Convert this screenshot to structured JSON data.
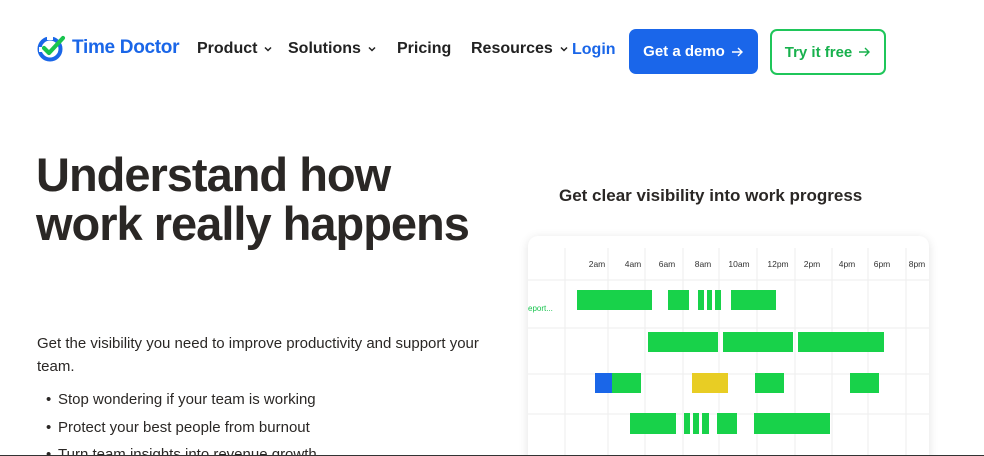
{
  "brand": {
    "name": "Time Doctor",
    "color": "#1a66e8"
  },
  "nav": {
    "items": [
      {
        "label": "Product",
        "dropdown": true
      },
      {
        "label": "Solutions",
        "dropdown": true
      },
      {
        "label": "Pricing",
        "dropdown": false
      },
      {
        "label": "Resources",
        "dropdown": true
      }
    ],
    "login": "Login",
    "demo_button": "Get a demo",
    "try_button": "Try it free"
  },
  "hero": {
    "title": "Understand how work really happens",
    "subtitle": "Get the visibility you need to improve productivity and support your team.",
    "bullets": [
      "Stop wondering if your team is working",
      "Protect your best people from burnout",
      "Turn team insights into revenue growth"
    ]
  },
  "visibility": {
    "title": "Get clear visibility into work progress",
    "row_label_partial": "eport...",
    "time_labels": [
      "2am",
      "4am",
      "6am",
      "8am",
      "10am",
      "12pm",
      "2pm",
      "4pm",
      "6pm",
      "8pm"
    ],
    "colors": {
      "active": "#18d24a",
      "manual": "#1a66e8",
      "idle": "#e8cd24"
    }
  }
}
